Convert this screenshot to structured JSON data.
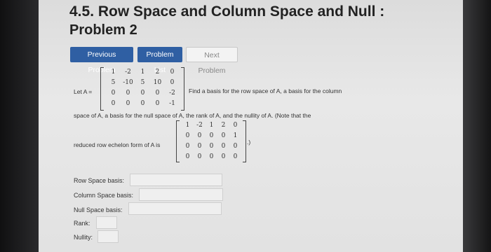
{
  "header": {
    "title": "4.5. Row Space and Column Space and Null :",
    "problem": "Problem 2"
  },
  "nav": {
    "previous": "Previous Problem",
    "list": "Problem List",
    "next": "Next Problem"
  },
  "problem": {
    "let_label": "Let A =",
    "text_right": "Find a basis for the row space of A, a basis for the column",
    "text_line2": "space of A, a basis for the null space of A, the rank of A, and the nullity of A. (Note that the",
    "rref_label": "reduced row echelon form of A is",
    "rref_close": ".)",
    "matrix_A": [
      [
        "1",
        "-2",
        "1",
        "2",
        "0"
      ],
      [
        "5",
        "-10",
        "5",
        "10",
        "0"
      ],
      [
        "0",
        "0",
        "0",
        "0",
        "-2"
      ],
      [
        "0",
        "0",
        "0",
        "0",
        "-1"
      ]
    ],
    "matrix_rref": [
      [
        "1",
        "-2",
        "1",
        "2",
        "0"
      ],
      [
        "0",
        "0",
        "0",
        "0",
        "1"
      ],
      [
        "0",
        "0",
        "0",
        "0",
        "0"
      ],
      [
        "0",
        "0",
        "0",
        "0",
        "0"
      ]
    ]
  },
  "answers": {
    "row_space_label": "Row Space basis:",
    "column_space_label": "Column Space basis:",
    "null_space_label": "Null Space basis:",
    "rank_label": "Rank:",
    "nullity_label": "Nullity:",
    "row_space_value": "",
    "column_space_value": "",
    "null_space_value": "",
    "rank_value": "",
    "nullity_value": ""
  }
}
